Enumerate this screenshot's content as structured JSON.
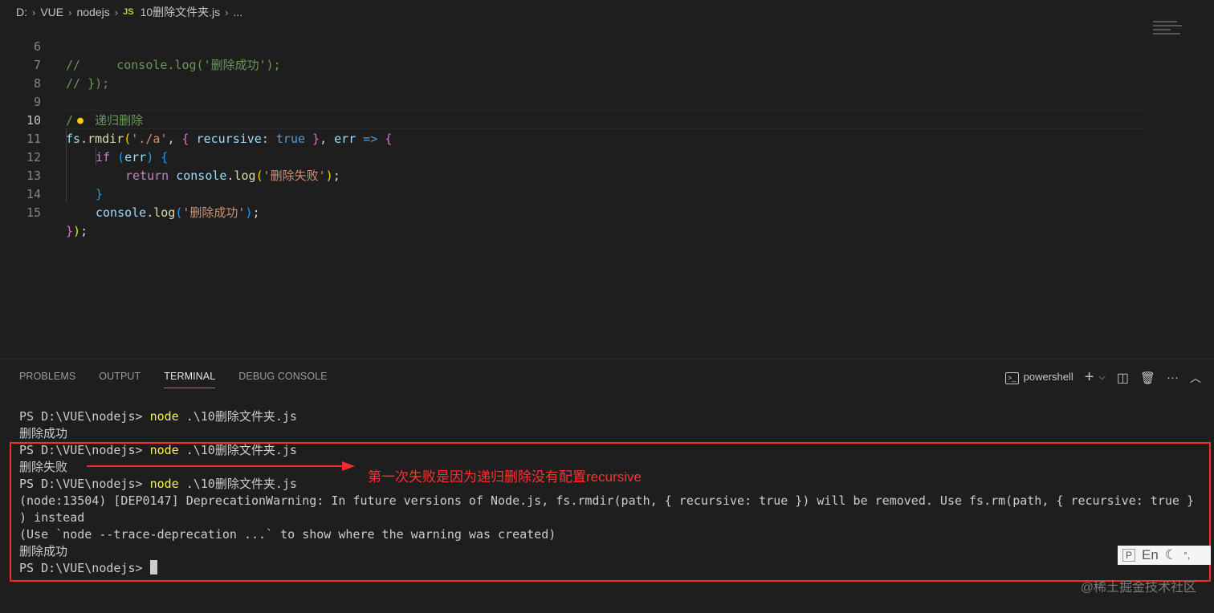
{
  "breadcrumb": {
    "items": [
      "D:",
      "VUE",
      "nodejs"
    ],
    "file_icon": "JS",
    "file": "10删除文件夹.js",
    "tail": "..."
  },
  "editor": {
    "active_line": "10",
    "lines": [
      {
        "n": "6",
        "t1": "//     console.log('删除成功');"
      },
      {
        "n": "7",
        "t1": "// });"
      },
      {
        "n": "8"
      },
      {
        "n": "9",
        "t1": "递归删除"
      },
      {
        "n": "10",
        "t1": "fs",
        "t2": ".",
        "t3": "rmdir",
        "t4": "(",
        "t5": "'./a'",
        "t6": ", ",
        "t7": "{",
        "t8": " recursive",
        "t9": ": ",
        "t10": "true",
        "t11": " }",
        "t12": ", ",
        "t13": "err",
        "t14": " => ",
        "t15": "{"
      },
      {
        "n": "11",
        "t1": "if",
        "t2": " ",
        "t3": "(",
        "t4": "err",
        "t5": ")",
        "t6": " {"
      },
      {
        "n": "12",
        "t1": "return",
        "t2": " ",
        "t3": "console",
        "t4": ".",
        "t5": "log",
        "t6": "(",
        "t7": "'删除失败'",
        "t8": ")",
        "t9": ";"
      },
      {
        "n": "13",
        "t1": "}"
      },
      {
        "n": "14",
        "t1": "console",
        "t2": ".",
        "t3": "log",
        "t4": "(",
        "t5": "'删除成功'",
        "t6": ")",
        "t7": ";"
      },
      {
        "n": "15",
        "t1": "}",
        "t2": ")",
        "t3": ";"
      }
    ],
    "comment_prefix": "/"
  },
  "panel": {
    "tabs": [
      "PROBLEMS",
      "OUTPUT",
      "TERMINAL",
      "DEBUG CONSOLE"
    ],
    "active_tab": "TERMINAL",
    "shell_label": "powershell",
    "icons": [
      "terminal-icon",
      "plus-icon",
      "chevron-down-icon",
      "split-icon",
      "trash-icon",
      "more-icon",
      "chevron-up-icon"
    ]
  },
  "terminal": {
    "prompt": "PS D:\\VUE\\nodejs> ",
    "cmd": "node",
    "arg": " .\\10删除文件夹.js",
    "out_success": "删除成功",
    "out_fail": "删除失败",
    "warn1": "(node:13504) [DEP0147] DeprecationWarning: In future versions of Node.js, fs.rmdir(path, { recursive: true }) will be removed. Use fs.rm(path, { recursive: true }",
    "warn2": ") instead",
    "warn3": "(Use `node --trace-deprecation ...` to show where the warning was created)"
  },
  "annotation": {
    "text": "第一次失败是因为递归删除没有配置recursive",
    "color": "#ff2b2b"
  },
  "ime": {
    "p": "P",
    "en": "En",
    "moon": "☾",
    "punct": "°,"
  },
  "watermark": "@稀土掘金技术社区"
}
